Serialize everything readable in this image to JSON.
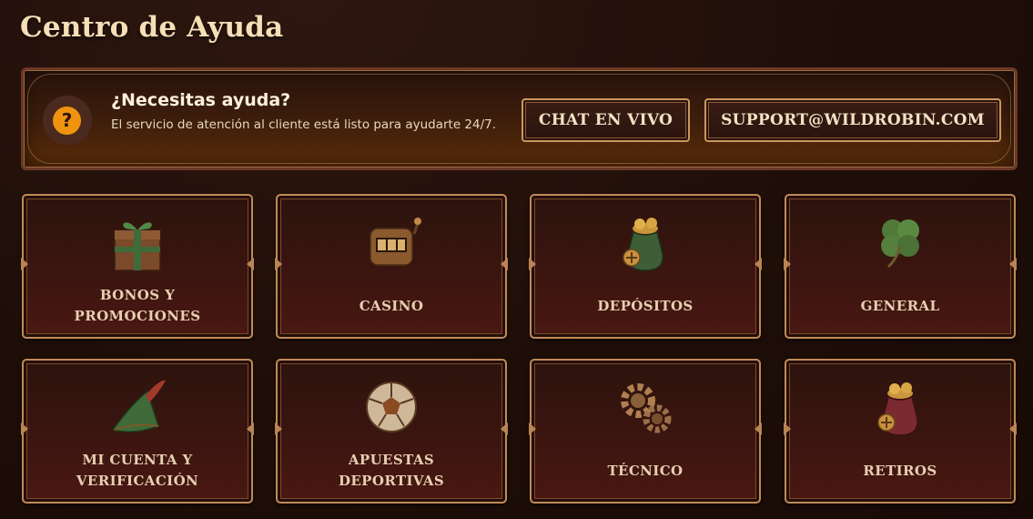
{
  "page": {
    "title": "Centro de Ayuda"
  },
  "banner": {
    "heading": "¿Necesitas ayuda?",
    "description": "El servicio de atención al cliente está listo para ayudarte 24/7.",
    "chat_label": "CHAT EN VIVO",
    "email_label": "SUPPORT@WILDROBIN.COM",
    "help_icon": "question-icon"
  },
  "categories": [
    {
      "label": "BONOS Y\nPROMOCIONES",
      "icon": "gift-box-icon"
    },
    {
      "label": "CASINO",
      "icon": "slot-machine-icon"
    },
    {
      "label": "DEPÓSITOS",
      "icon": "money-bag-green-icon"
    },
    {
      "label": "GENERAL",
      "icon": "four-leaf-clover-icon"
    },
    {
      "label": "MI CUENTA Y\nVERIFICACIÓN",
      "icon": "feathered-hat-icon"
    },
    {
      "label": "APUESTAS\nDEPORTIVAS",
      "icon": "soccer-ball-icon"
    },
    {
      "label": "TÉCNICO",
      "icon": "gears-icon"
    },
    {
      "label": "RETIROS",
      "icon": "money-bag-red-icon"
    }
  ]
}
